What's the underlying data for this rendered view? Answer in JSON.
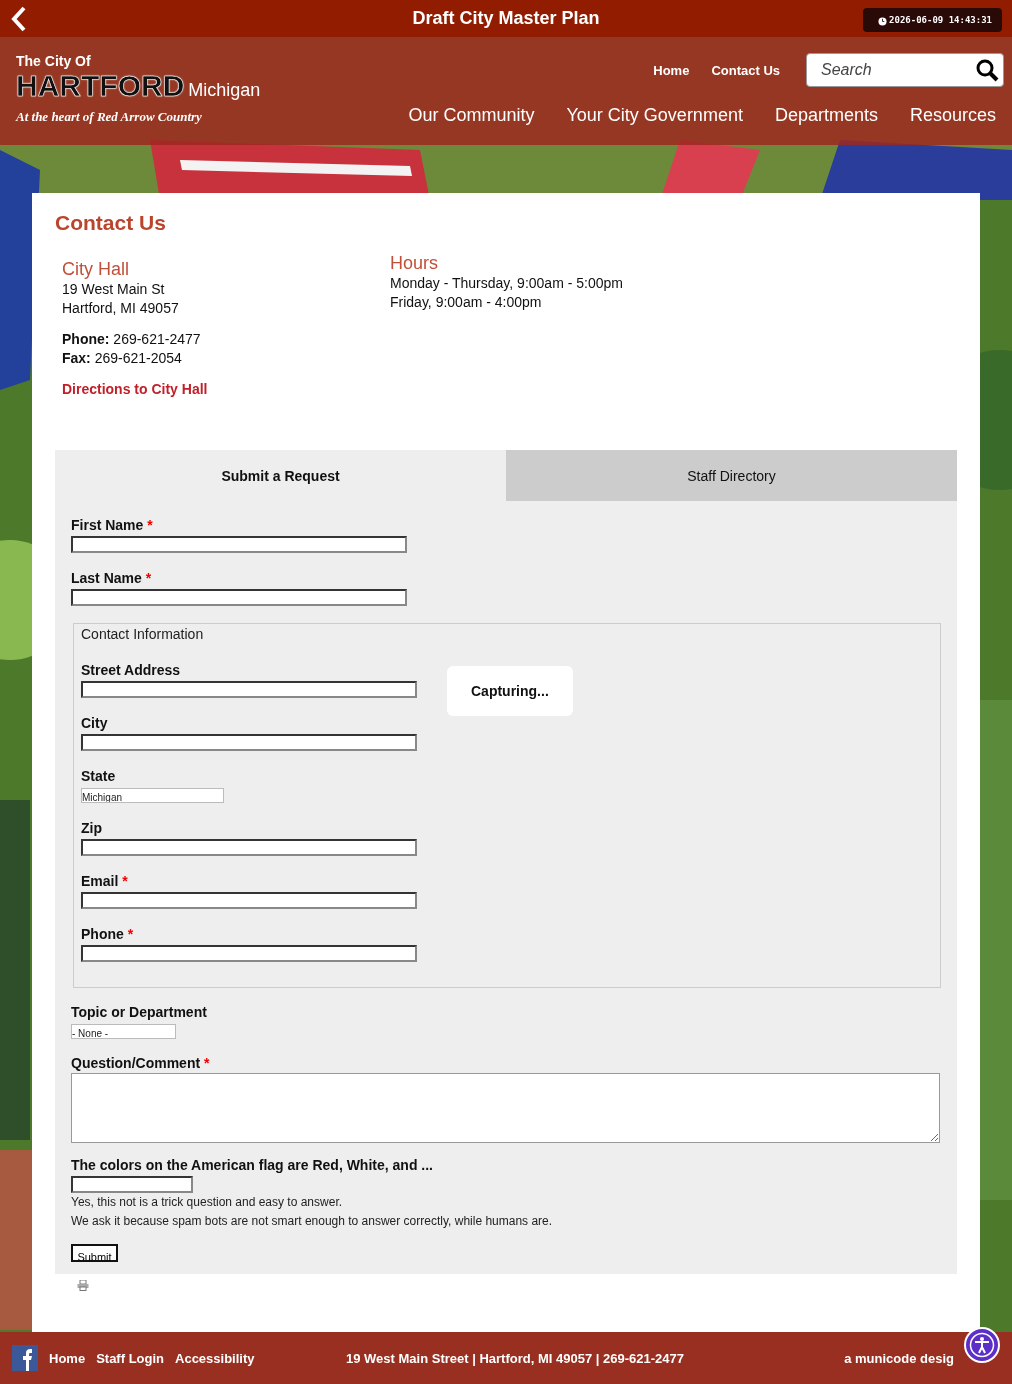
{
  "top_bar": {
    "title": "Draft City Master Plan",
    "timestamp": "2026-06-09 14:43:31"
  },
  "header": {
    "city_of": "The City Of",
    "city": "HARTFORD",
    "state": "Michigan",
    "tagline": "At the heart of Red Arrow Country",
    "utility_links": [
      "Home",
      "Contact Us"
    ],
    "search": {
      "placeholder": "Search"
    },
    "nav": [
      "Our Community",
      "Your City Government",
      "Departments",
      "Resources"
    ]
  },
  "page_title": "Contact Us",
  "city_hall": {
    "heading": "City Hall",
    "address_lines": [
      "19 West Main St",
      "Hartford, MI 49057"
    ],
    "contacts": [
      {
        "label": "Phone:",
        "value": "269-621-2477"
      },
      {
        "label": "Fax:",
        "value": "269-621-2054"
      }
    ],
    "directions_link": "Directions to City Hall"
  },
  "hours": {
    "heading": "Hours",
    "lines": [
      "Monday - Thursday, 9:00am - 5:00pm",
      "Friday, 9:00am - 4:00pm"
    ]
  },
  "tabs": [
    {
      "label": "Submit a Request",
      "selected": true
    },
    {
      "label": "Staff Directory",
      "selected": false
    }
  ],
  "form": {
    "fields": [
      {
        "label": "First Name",
        "required": true
      },
      {
        "label": "Last Name",
        "required": true
      }
    ],
    "contact_group": {
      "legend": "Contact Information",
      "fields": [
        {
          "label": "Street Address",
          "required": false,
          "kind": "text"
        },
        {
          "label": "City",
          "required": false,
          "kind": "text"
        },
        {
          "label": "State",
          "required": false,
          "kind": "select",
          "value": "Michigan"
        },
        {
          "label": "Zip",
          "required": false,
          "kind": "text"
        },
        {
          "label": "Email",
          "required": true,
          "kind": "text"
        },
        {
          "label": "Phone",
          "required": true,
          "kind": "text"
        }
      ]
    },
    "topic": {
      "label": "Topic or Department",
      "value": "- None -"
    },
    "comment": {
      "label": "Question/Comment",
      "required": true
    },
    "captcha": {
      "question": "The colors on the American flag are Red, White, and ...",
      "hints": [
        "Yes, this not is a trick question and easy to answer.",
        "We ask it because spam bots are not smart enough to answer correctly, while humans are."
      ]
    },
    "submit": "Submit"
  },
  "required_mark": "*",
  "capture_badge": "Capturing...",
  "footer": {
    "links": [
      "Home",
      "Staff Login",
      "Accessibility"
    ],
    "address": "19 West Main Street | Hartford, MI 49057 | 269-621-2477",
    "credit": "a municode desig"
  }
}
